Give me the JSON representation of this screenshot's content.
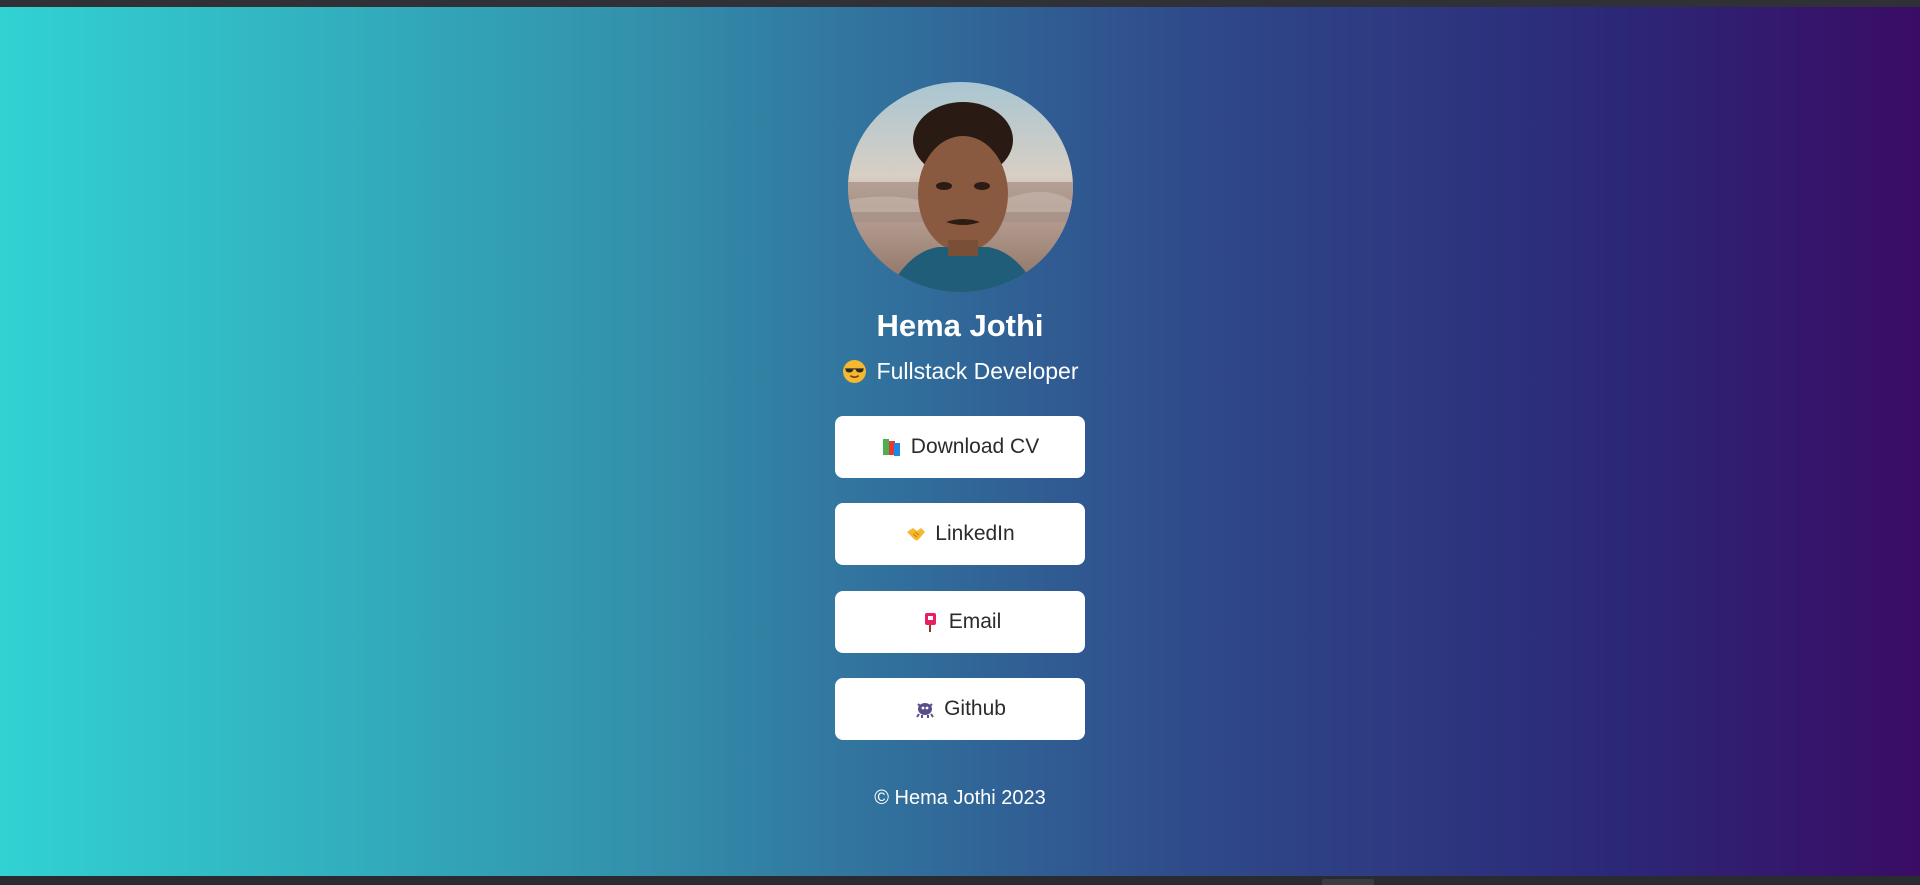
{
  "profile": {
    "name": "Hema Jothi",
    "role_emoji": "sunglasses-face",
    "role": "Fullstack Developer"
  },
  "buttons": [
    {
      "label": "Download CV",
      "icon": "books-icon"
    },
    {
      "label": "LinkedIn",
      "icon": "handshake-icon"
    },
    {
      "label": "Email",
      "icon": "mailbox-icon"
    },
    {
      "label": "Github",
      "icon": "octocat-icon"
    }
  ],
  "footer": {
    "text": "© Hema Jothi 2023"
  },
  "colors": {
    "gradient_start": "#31d2d3",
    "gradient_end": "#3a0c65",
    "button_bg": "#ffffff",
    "button_text": "#2b2b2b"
  }
}
